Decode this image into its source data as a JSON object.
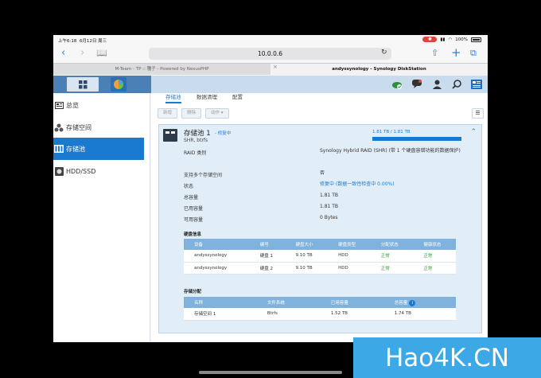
{
  "status_bar": {
    "time": "上午6:18",
    "date": "6月12日 周三",
    "battery": "100%"
  },
  "browser": {
    "url": "10.0.0.6"
  },
  "tabs": [
    {
      "label": "M-Team - TP :: 種子 - Powered by NexusPHP"
    },
    {
      "label": "andyssynology - Synology DiskStation"
    }
  ],
  "sidebar": {
    "items": [
      {
        "label": "总览"
      },
      {
        "label": "存储空间"
      },
      {
        "label": "存储池"
      },
      {
        "label": "HDD/SSD"
      }
    ]
  },
  "main": {
    "tabs": [
      {
        "label": "存储池"
      },
      {
        "label": "数据清理"
      },
      {
        "label": "配置"
      }
    ],
    "buttons": {
      "new": "新增",
      "delete": "删除",
      "action": "动作 ▾"
    }
  },
  "pool": {
    "title": "存储池 1",
    "status": "- 修复中",
    "subtitle": "SHR, btrfs",
    "usage_text": "1.81 TB / 1.81 TB",
    "usage_fraction": 1.0,
    "properties": [
      {
        "label": "RAID 类别",
        "value": "Synology Hybrid RAID (SHR) (带 1 个硬盘容错功能的数据保护)"
      },
      {
        "label": "支持多个存储空间",
        "value": "否"
      },
      {
        "label": "状态",
        "value": "修复中 (数据一致性检查中 0.00%)"
      },
      {
        "label": "总容量",
        "value": "1.81 TB"
      },
      {
        "label": "已用容量",
        "value": "1.81 TB"
      },
      {
        "label": "可用容量",
        "value": "0 Bytes"
      }
    ]
  },
  "disk_info": {
    "title": "硬盘信息",
    "headers": [
      "设备",
      "编号",
      "硬盘大小",
      "硬盘类型",
      "分配状态",
      "健康状态"
    ],
    "rows": [
      [
        "andyssynology",
        "硬盘 1",
        "9.10 TB",
        "HDD",
        "正常",
        "正常"
      ],
      [
        "andyssynology",
        "硬盘 2",
        "9.10 TB",
        "HDD",
        "正常",
        "正常"
      ]
    ]
  },
  "allocation": {
    "title": "存储分配",
    "headers": [
      "名称",
      "文件系统",
      "已用容量",
      "总容量"
    ],
    "rows": [
      [
        "存储空间 1",
        "Btrfs",
        "1.52 TB",
        "1.74 TB"
      ]
    ]
  },
  "watermark": "Hao4K.CN",
  "colors": {
    "accent": "#1a7ad0",
    "ok": "#30a030",
    "taskbar": "#4a80b5"
  }
}
